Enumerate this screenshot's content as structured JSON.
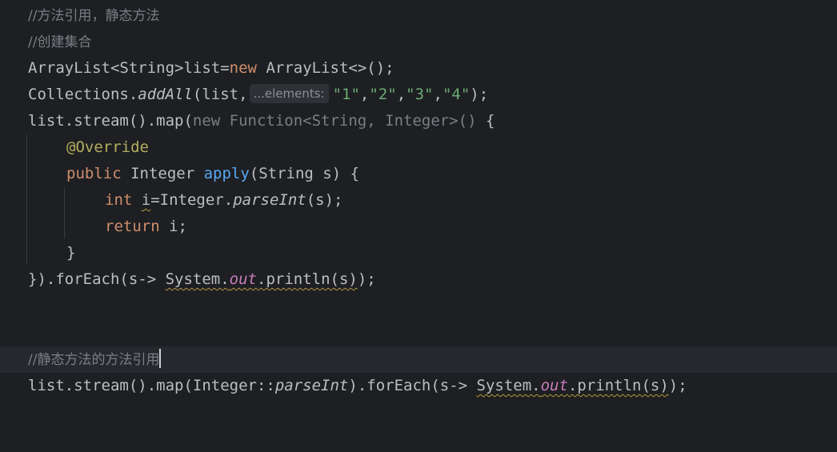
{
  "editor": {
    "lines": {
      "l1": {
        "comment": "//方法引用，静态方法"
      },
      "l2": {
        "comment": "//创建集合"
      },
      "l3": {
        "a": "ArrayList<String>list=",
        "kw": "new",
        "b": " ArrayList<>();"
      },
      "l4": {
        "a": "Collections.",
        "m": "addAll",
        "b": "(list,",
        "hint": "...elements:",
        "s1": "\"1\"",
        "c1": ",",
        "s2": "\"2\"",
        "c2": ",",
        "s3": "\"3\"",
        "c3": ",",
        "s4": "\"4\"",
        "end": ");"
      },
      "l5": {
        "a": "list.stream().map(",
        "gray": "new Function<String, Integer>()",
        "b": " {"
      },
      "l6": {
        "anno": "@Override"
      },
      "l7": {
        "kw": "public",
        "a": " Integer ",
        "m": "apply",
        "b": "(String s) {"
      },
      "l8": {
        "kw": "int",
        "sp": " ",
        "v": "i",
        "a": "=Integer.",
        "m": "parseInt",
        "b": "(s);"
      },
      "l9": {
        "kw": "return",
        "a": " i;"
      },
      "l10": {
        "a": "}"
      },
      "l11": {
        "a": "}).forEach(s-> ",
        "sys": "System.",
        "out": "out",
        "pr": ".println(s)",
        "end": ");"
      },
      "l12": {
        "comment": "//静态方法的方法引用"
      },
      "l13": {
        "a": "list.stream().map(Integer::",
        "m": "parseInt",
        "b": ").forEach(s-> ",
        "sys": "System.",
        "out": "out",
        "pr": ".println(s)",
        "end": ");"
      }
    }
  }
}
